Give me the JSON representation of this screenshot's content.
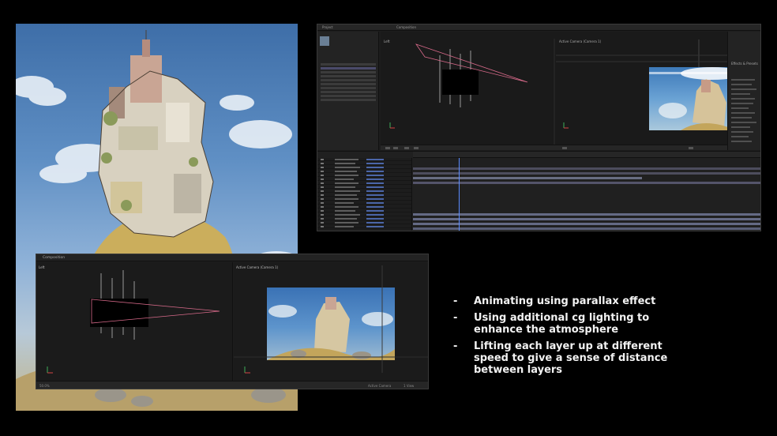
{
  "bullets": [
    "Animating using parallax effect",
    "Using additional cg lighting to enhance the atmosphere",
    "Lifting each layer up at different speed to give a sense of distance between layers"
  ],
  "bullet_marker": "-",
  "bottom_window": {
    "tab_label": "Composition",
    "left_view_label": "Left",
    "right_view_label": "Active Camera (Camera 1)",
    "footer_camera": "Active Camera",
    "footer_zoom": "50.0%",
    "footer_view": "1 View"
  },
  "top_window": {
    "viewer_tab": "Composition",
    "left_view_label": "Left",
    "right_view_label": "Active Camera (Camera 1)",
    "project_label": "Project",
    "effects_label": "Effects & Presets"
  },
  "colors": {
    "background": "#000000",
    "text": "#f2f2f2",
    "panel": "#1d1d1d",
    "playhead": "#5b8cff",
    "camera_line": "#d86a8a"
  }
}
